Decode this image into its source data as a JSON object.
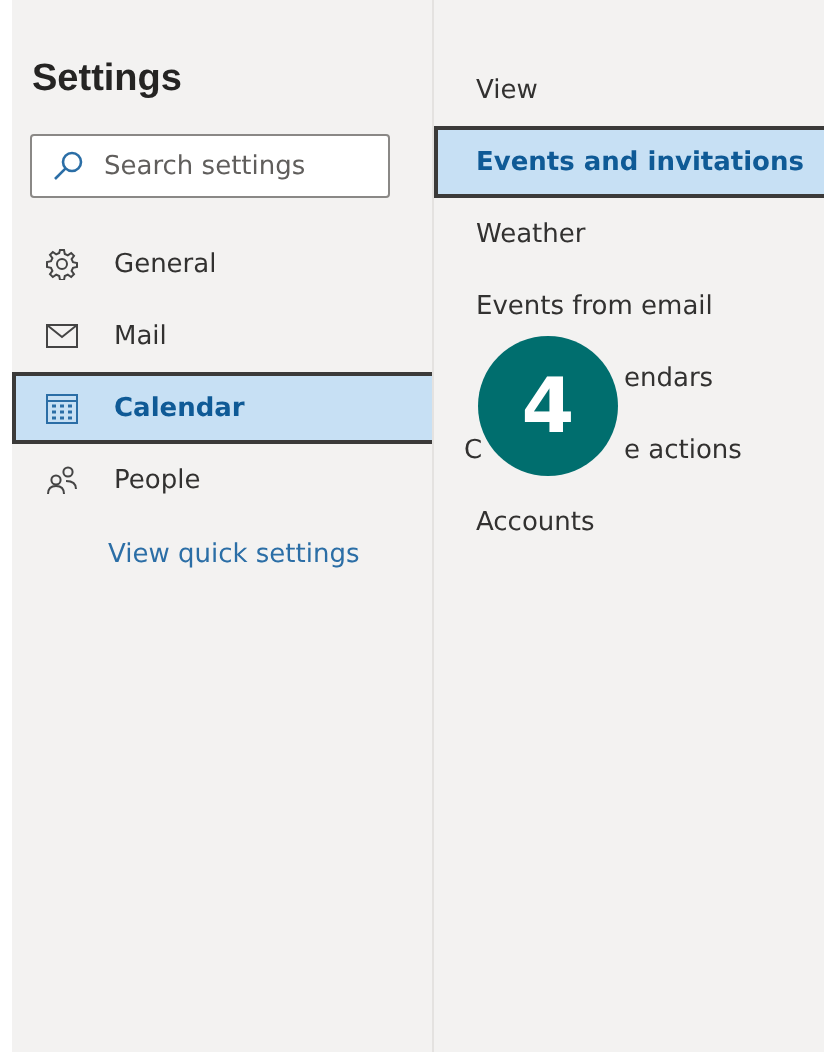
{
  "sidebar": {
    "title": "Settings",
    "search": {
      "placeholder": "Search settings"
    },
    "items": [
      {
        "label": "General",
        "selected": false
      },
      {
        "label": "Mail",
        "selected": false
      },
      {
        "label": "Calendar",
        "selected": true
      },
      {
        "label": "People",
        "selected": false
      }
    ],
    "link": "View quick settings"
  },
  "submenu": {
    "items": [
      {
        "label": "View",
        "selected": false
      },
      {
        "label": "Events and invitations",
        "selected": true
      },
      {
        "label": "Weather",
        "selected": false
      },
      {
        "label": "Events from email",
        "selected": false
      },
      {
        "after": "endars",
        "selected": false
      },
      {
        "before": "C",
        "after": "e actions",
        "selected": false
      },
      {
        "label": "Accounts",
        "selected": false
      }
    ]
  },
  "step_badge": "4"
}
